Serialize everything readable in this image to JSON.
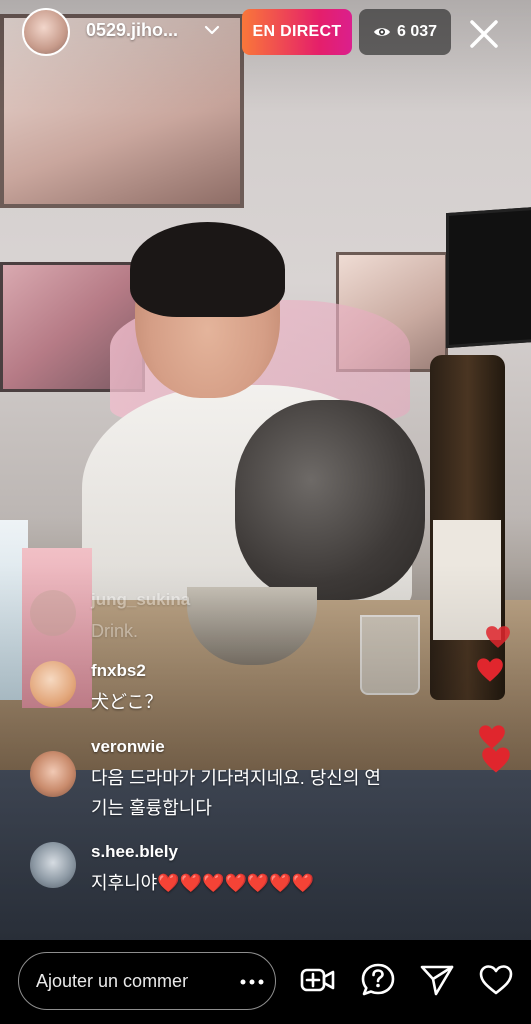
{
  "header": {
    "host_username": "0529.jiho...",
    "live_label": "EN DIRECT",
    "viewer_count": "6 037"
  },
  "comments": [
    {
      "username": "jung_sukina",
      "text": "Drink."
    },
    {
      "username": "fnxbs2",
      "text": "犬どこ？"
    },
    {
      "username": "veronwie",
      "text_line1": "다음 드라마가 기다려지네요. 당신의 연",
      "text_line2": "기는 훌륭합니다"
    },
    {
      "username": "s.hee.blely",
      "text": "지후니야❤️❤️❤️❤️❤️❤️❤️"
    }
  ],
  "bottom_bar": {
    "comment_placeholder": "Ajouter un commentaire…",
    "icons": [
      "more-icon",
      "add-video-guest-icon",
      "question-icon",
      "send-icon",
      "heart-icon"
    ]
  },
  "colors": {
    "live_gradient_start": "#f9773a",
    "live_gradient_end": "#db1f8d",
    "heart_red": "#e0262d"
  }
}
